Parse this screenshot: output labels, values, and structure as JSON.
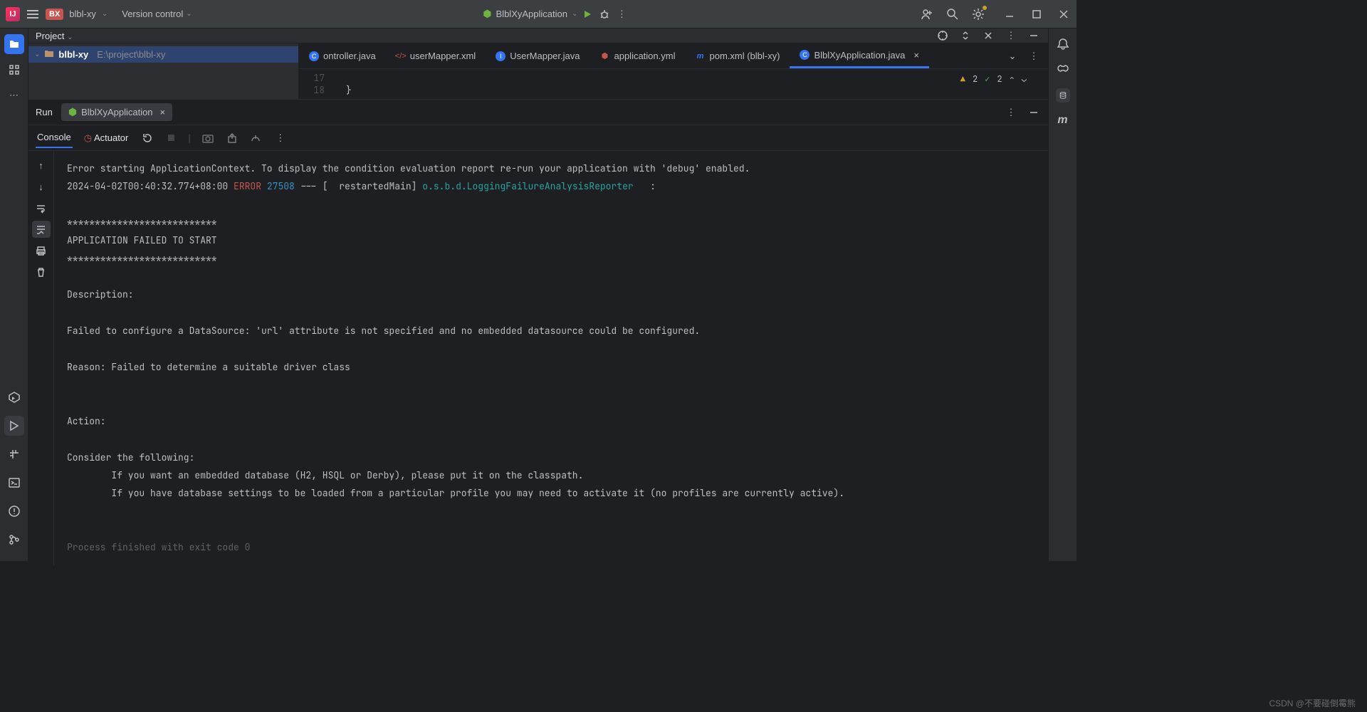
{
  "titlebar": {
    "project_badge": "BX",
    "project_name": "blbl-xy",
    "version_control": "Version control"
  },
  "run_config": {
    "name": "BlblXyApplication"
  },
  "project_tool": {
    "title": "Project"
  },
  "tree": {
    "root_name": "blbl-xy",
    "root_path": "E:\\project\\blbl-xy"
  },
  "editor_tabs": [
    {
      "label": "ontroller.java",
      "type": "java",
      "active": false
    },
    {
      "label": "userMapper.xml",
      "type": "xml",
      "active": false
    },
    {
      "label": "UserMapper.java",
      "type": "java",
      "active": false
    },
    {
      "label": "application.yml",
      "type": "yml",
      "active": false
    },
    {
      "label": "pom.xml (blbl-xy)",
      "type": "maven",
      "active": false
    },
    {
      "label": "BlblXyApplication.java",
      "type": "java",
      "active": true
    }
  ],
  "editor": {
    "line_a": "17",
    "line_b": "18",
    "code_b": "}",
    "warn_count": "2",
    "ok_count": "2"
  },
  "run_panel": {
    "title": "Run",
    "tab_name": "BlblXyApplication",
    "console_tab": "Console",
    "actuator_tab": "Actuator"
  },
  "console": {
    "l1": "Error starting ApplicationContext. To display the condition evaluation report re-run your application with 'debug' enabled.",
    "ts": "2024-04-02T00:40:32.774+08:00",
    "level": "ERROR",
    "pid": "27508",
    "thread": " --- [  restartedMain] ",
    "cls": "o.s.b.d.LoggingFailureAnalysisReporter",
    "tail": "   :",
    "stars": "***************************",
    "fail": "APPLICATION FAILED TO START",
    "desc_h": "Description:",
    "desc": "Failed to configure a DataSource: 'url' attribute is not specified and no embedded datasource could be configured.",
    "reason": "Reason: Failed to determine a suitable driver class",
    "action_h": "Action:",
    "consider": "Consider the following:",
    "opt1": "\tIf you want an embedded database (H2, HSQL or Derby), please put it on the classpath.",
    "opt2": "\tIf you have database settings to be loaded from a particular profile you may need to activate it (no profiles are currently active).",
    "exit": "Process finished with exit code 0"
  },
  "watermark": "CSDN @不要碰倒霉熊"
}
